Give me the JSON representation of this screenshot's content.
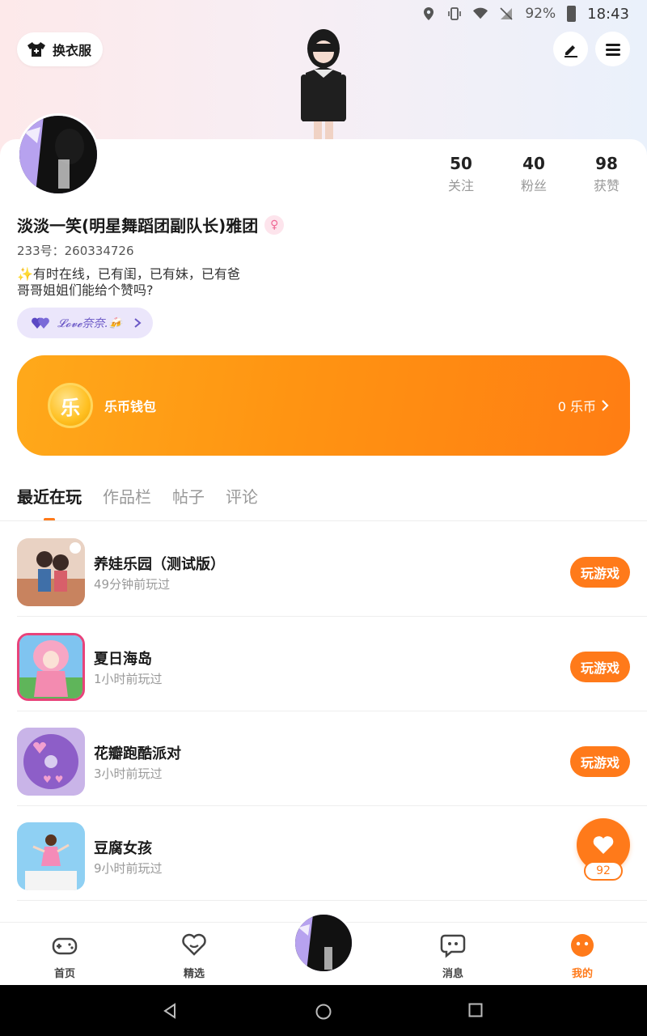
{
  "status": {
    "battery_pct": "92%",
    "time": "18:43"
  },
  "header": {
    "outfit_label": "换衣服"
  },
  "profile": {
    "stats": [
      {
        "num": "50",
        "label": "关注"
      },
      {
        "num": "40",
        "label": "粉丝"
      },
      {
        "num": "98",
        "label": "获赞"
      }
    ],
    "username": "淡淡一笑(明星舞蹈团副队长)雅团",
    "uid": "233号：260334726",
    "bio_line1": "✨有时在线，已有闺，已有妹，已有爸",
    "bio_line2": "哥哥姐姐们能给个赞吗?",
    "love_tag": "𝓛𝓸𝓿𝓮奈奈.🍻"
  },
  "wallet": {
    "coin_char": "乐",
    "label": "乐币钱包",
    "balance": "0 乐币"
  },
  "tabs": [
    {
      "label": "最近在玩",
      "active": true
    },
    {
      "label": "作品栏",
      "active": false
    },
    {
      "label": "帖子",
      "active": false
    },
    {
      "label": "评论",
      "active": false
    }
  ],
  "games": [
    {
      "name": "养娃乐园（测试版）",
      "time": "49分钟前玩过",
      "button": "玩游戏"
    },
    {
      "name": "夏日海岛",
      "time": "1小时前玩过",
      "button": "玩游戏"
    },
    {
      "name": "花瓣跑酷派对",
      "time": "3小时前玩过",
      "button": "玩游戏"
    },
    {
      "name": "豆腐女孩",
      "time": "9小时前玩过",
      "button": ""
    }
  ],
  "like": {
    "count": "92"
  },
  "nav": [
    {
      "label": "首页"
    },
    {
      "label": "精选"
    },
    {
      "label": "消息"
    },
    {
      "label": "我的"
    }
  ],
  "colors": {
    "accent": "#ff7a1a",
    "wallet_start": "#ffa91a",
    "wallet_end": "#ff7d13"
  }
}
